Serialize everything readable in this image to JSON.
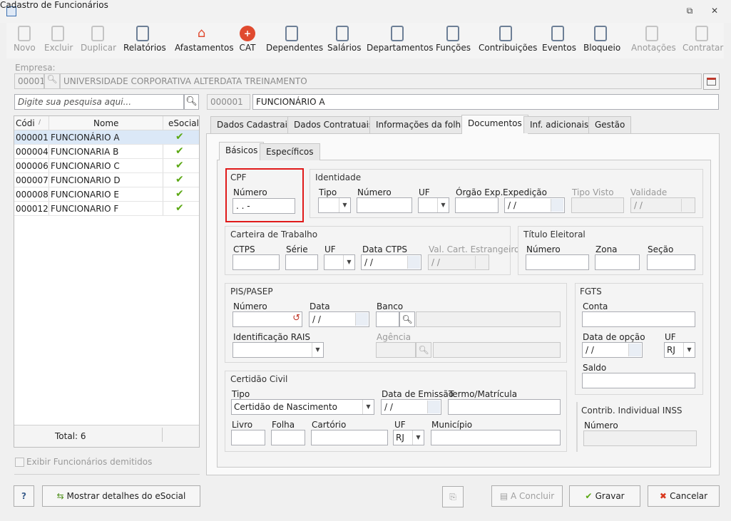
{
  "window": {
    "title": "Cadastro de Funcionários"
  },
  "toolbar": [
    {
      "label": "Novo",
      "icon": "new-document-icon",
      "enabled": false
    },
    {
      "label": "Excluir",
      "icon": "trash-icon",
      "enabled": false
    },
    {
      "label": "Duplicar",
      "icon": "duplicate-users-icon",
      "enabled": false
    },
    {
      "label": "Relatórios",
      "icon": "report-icon",
      "enabled": true
    },
    {
      "label": "Afastamentos",
      "icon": "house-arrow-icon",
      "enabled": true
    },
    {
      "label": "CAT",
      "icon": "red-cross-icon",
      "enabled": true
    },
    {
      "label": "Dependentes",
      "icon": "dependents-icon",
      "enabled": true
    },
    {
      "label": "Salários",
      "icon": "salary-card-icon",
      "enabled": true
    },
    {
      "label": "Departamentos",
      "icon": "department-desk-icon",
      "enabled": true
    },
    {
      "label": "Funções",
      "icon": "badge-icon",
      "enabled": true
    },
    {
      "label": "Contribuições",
      "icon": "contributions-icon",
      "enabled": true
    },
    {
      "label": "Eventos",
      "icon": "events-list-icon",
      "enabled": true
    },
    {
      "label": "Bloqueio",
      "icon": "lock-icon",
      "enabled": true
    },
    {
      "label": "Anotações",
      "icon": "notes-icon",
      "enabled": false
    },
    {
      "label": "Contratar",
      "icon": "hire-check-icon",
      "enabled": false
    }
  ],
  "empresa": {
    "label": "Empresa:",
    "code": "00001",
    "name": "UNIVERSIDADE CORPORATIVA ALTERDATA TREINAMENTO"
  },
  "search": {
    "placeholder": "Digite sua pesquisa aqui..."
  },
  "employee": {
    "code": "000001",
    "name": "FUNCIONÁRIO A"
  },
  "grid": {
    "headers": [
      "Códi",
      "Nome",
      "eSocial"
    ],
    "rows": [
      {
        "code": "000001",
        "name": "FUNCIONÁRIO A",
        "esocial": "✔"
      },
      {
        "code": "000004",
        "name": "FUNCIONARIA B",
        "esocial": "✔"
      },
      {
        "code": "000006",
        "name": "FUNCIONARIO C",
        "esocial": "✔"
      },
      {
        "code": "000007",
        "name": "FUNCIONARIO D",
        "esocial": "✔"
      },
      {
        "code": "000008",
        "name": "FUNCIONARIO E",
        "esocial": "✔"
      },
      {
        "code": "000012",
        "name": "FUNCIONARIO F",
        "esocial": "✔"
      }
    ],
    "total": "Total: 6"
  },
  "exibir_demitidos": "Exibir Funcionários demitidos",
  "tabs": [
    "Dados Cadastrais",
    "Dados Contratuais",
    "Informações da folha",
    "Documentos",
    "Inf. adicionais",
    "Gestão"
  ],
  "subtabs": [
    "Básicos",
    "Específicos"
  ],
  "cpf": {
    "title": "CPF",
    "numero_label": "Número",
    "value": " .  .  -"
  },
  "identidade": {
    "title": "Identidade",
    "tipo": "Tipo",
    "numero": "Número",
    "uf": "UF",
    "orgao": "Órgão Exp.",
    "expedicao": "Expedição",
    "expedicao_value": "/ /",
    "tipo_visto": "Tipo Visto",
    "validade": "Validade",
    "validade_value": "/ /"
  },
  "carteira": {
    "title": "Carteira de Trabalho",
    "ctps": "CTPS",
    "serie": "Série",
    "uf": "UF",
    "data_ctps": "Data CTPS",
    "data_value": "/ /",
    "val_cart": "Val. Cart. Estrangeiro",
    "val_value": "/ /"
  },
  "titulo": {
    "title": "Título Eleitoral",
    "numero": "Número",
    "zona": "Zona",
    "secao": "Seção"
  },
  "pis": {
    "title": "PIS/PASEP",
    "numero": "Número",
    "data": "Data",
    "data_value": "/ /",
    "banco": "Banco",
    "rais": "Identificação RAIS",
    "agencia": "Agência"
  },
  "fgts": {
    "title": "FGTS",
    "conta": "Conta",
    "data_opcao": "Data de opção",
    "data_value": "/ /",
    "uf": "UF",
    "uf_value": "RJ",
    "saldo": "Saldo"
  },
  "certidao": {
    "title": "Certidão Civil",
    "tipo": "Tipo",
    "tipo_value": "Certidão de Nascimento",
    "data_emissao": "Data de Emissão",
    "data_value": "/ /",
    "termo": "Termo/Matrícula",
    "livro": "Livro",
    "folha": "Folha",
    "cartorio": "Cartório",
    "uf": "UF",
    "uf_value": "RJ",
    "municipio": "Município"
  },
  "inss": {
    "title": "Contrib. Individual INSS",
    "numero": "Número"
  },
  "buttons": {
    "help": "?",
    "esocial": "Mostrar detalhes do eSocial",
    "concluir": "A Concluir",
    "gravar": "Gravar",
    "cancelar": "Cancelar"
  },
  "colors": {
    "highlight": "#e01a1a",
    "check": "#5ba814",
    "cross": "#d9381e"
  }
}
